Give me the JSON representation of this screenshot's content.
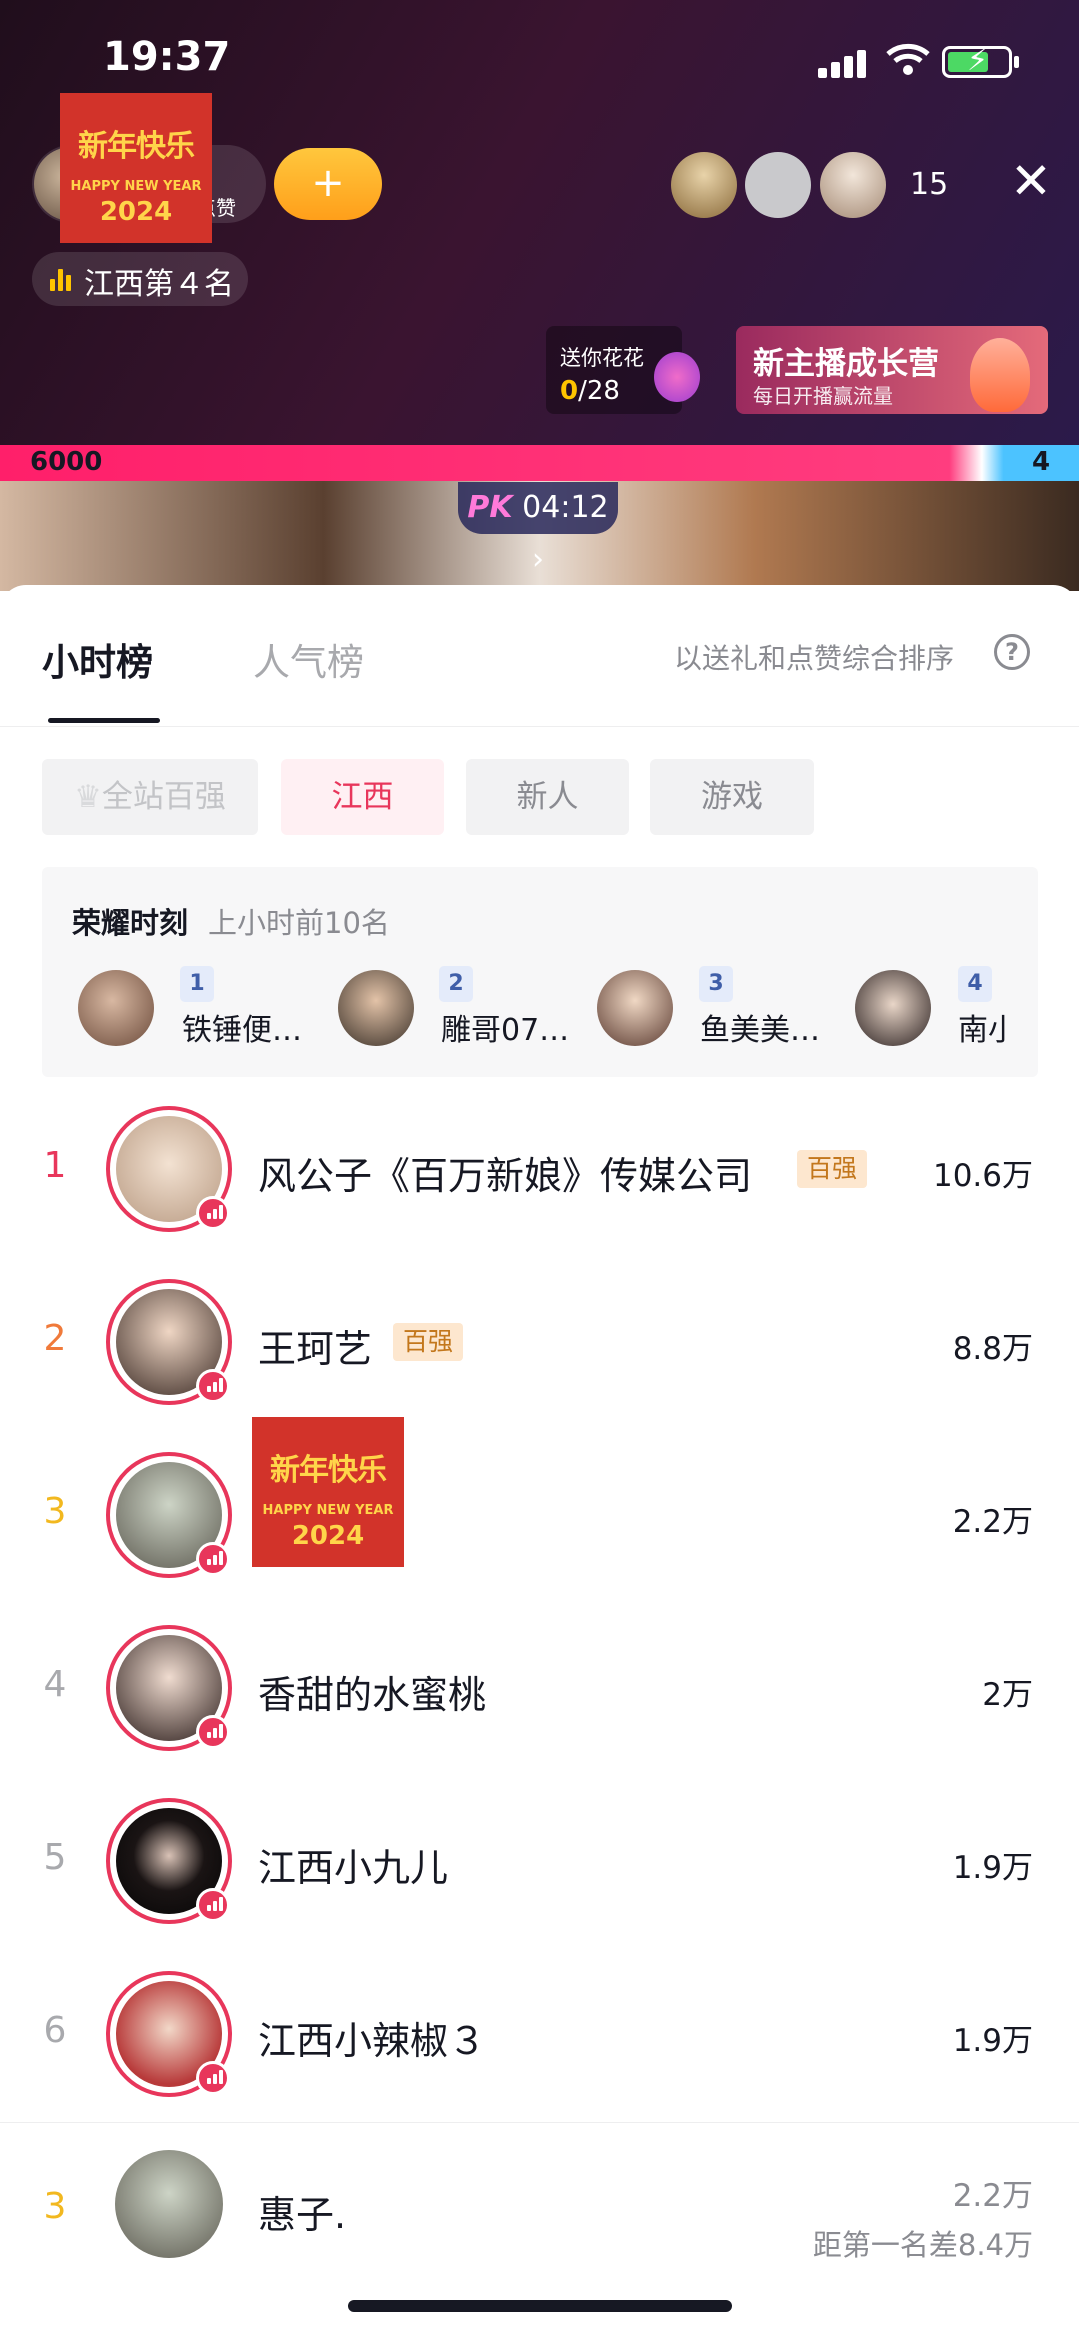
{
  "status_bar": {
    "time": "19:37"
  },
  "live_header": {
    "host_likes_label": "点赞",
    "follow_glyph": "+",
    "region_rank": "江西第４名",
    "audience_count": "15",
    "close_glyph": "✕",
    "badge": {
      "line1": "新年快乐",
      "line2": "HAPPY NEW YEAR",
      "line3": "2024"
    }
  },
  "gift_task": {
    "label": "送你花花",
    "progress": "0",
    "total": "/28"
  },
  "camp_banner": {
    "title": "新主播成长营",
    "subtitle": "每日开播赢流量"
  },
  "pk": {
    "left_score": "6000",
    "right_score": "4",
    "label": "PK",
    "timer": "04:12",
    "arrow": "›"
  },
  "sheet": {
    "tabs": [
      "小时榜",
      "人气榜"
    ],
    "sort_note": "以送礼和点赞综合排序",
    "help_glyph": "?",
    "filters": [
      "全站百强",
      "江西",
      "新人",
      "游戏"
    ]
  },
  "glory": {
    "title": "荣耀时刻",
    "subtitle": "上小时前10名",
    "items": [
      {
        "rank": "1",
        "name": "铁锤便…"
      },
      {
        "rank": "2",
        "name": "雕哥07…"
      },
      {
        "rank": "3",
        "name": "鱼美美…"
      },
      {
        "rank": "4",
        "name": "南小"
      }
    ]
  },
  "ranking": [
    {
      "rank": "1",
      "name": "风公子《百万新娘》传媒公司",
      "tag": "百强",
      "score": "10.6万",
      "rank_color": "#e8365b"
    },
    {
      "rank": "2",
      "name": "王珂艺",
      "tag": "百强",
      "score": "8.8万",
      "rank_color": "#f07a3a"
    },
    {
      "rank": "3",
      "name": "",
      "tag": "",
      "score": "2.2万",
      "rank_color": "#f2b81f"
    },
    {
      "rank": "4",
      "name": "香甜的水蜜桃",
      "tag": "",
      "score": "2万",
      "rank_color": "#a8a9ad"
    },
    {
      "rank": "5",
      "name": "江西小九儿",
      "tag": "",
      "score": "1.9万",
      "rank_color": "#a8a9ad"
    },
    {
      "rank": "6",
      "name": "江西小辣椒３",
      "tag": "",
      "score": "1.9万",
      "rank_color": "#a8a9ad"
    }
  ],
  "my_entry": {
    "rank": "3",
    "name": "惠子.",
    "score": "2.2万",
    "gap": "距第一名差8.4万"
  }
}
